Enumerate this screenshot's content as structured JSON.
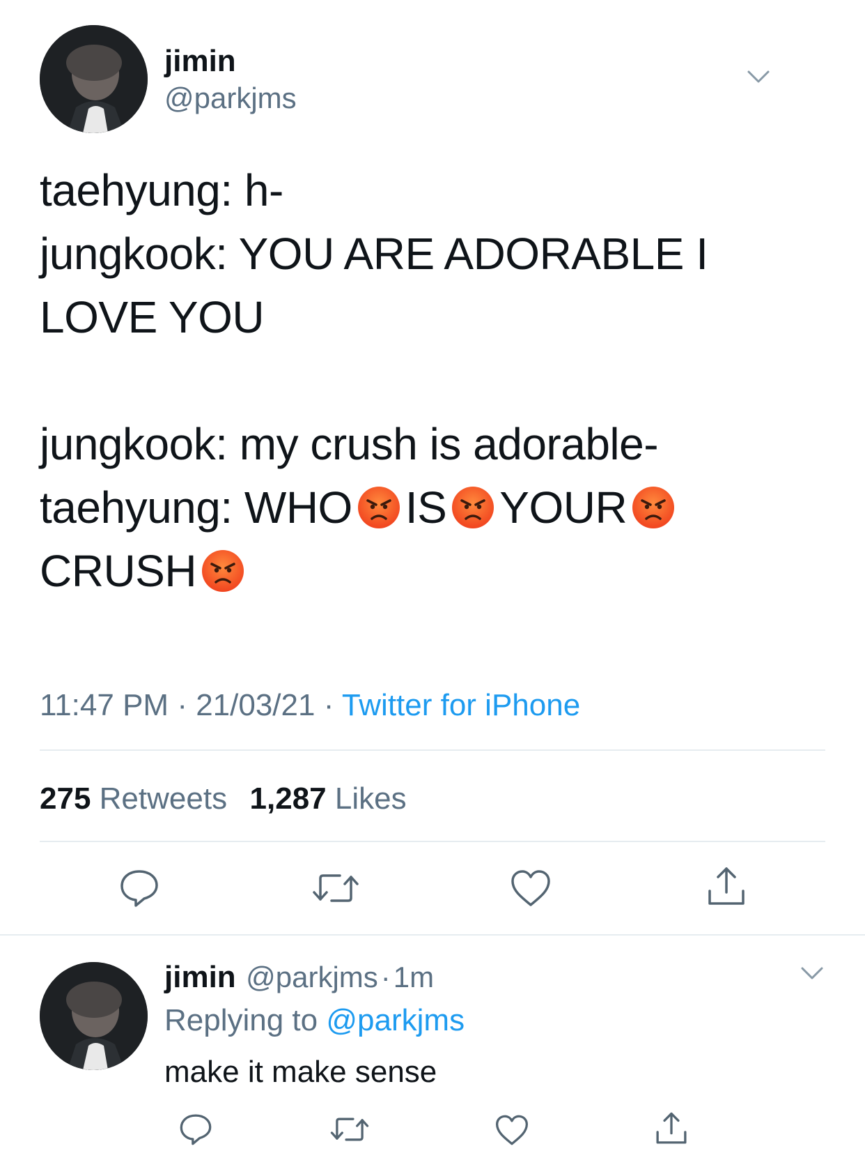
{
  "tweet": {
    "author_name": "jimin",
    "author_handle": "@parkjms",
    "lines": [
      "taehyung: h-",
      "jungkook: YOU ARE ADORABLE I",
      "LOVE YOU",
      "jungkook: my crush is adorable-"
    ],
    "line5_parts": [
      "taehyung: WHO",
      "IS",
      "YOUR"
    ],
    "line6_text": "CRUSH",
    "emoji": "angry-face",
    "time": "11:47 PM",
    "sep": "·",
    "date": "21/03/21",
    "source": "Twitter for iPhone",
    "retweets_count": "275",
    "retweets_label": "Retweets",
    "likes_count": "1,287",
    "likes_label": "Likes"
  },
  "reply": {
    "author_name": "jimin",
    "author_handle": "@parkjms",
    "sep": "·",
    "time_ago": "1m",
    "replying_prefix": "Replying to",
    "replying_handle": "@parkjms",
    "text": "make it make sense"
  },
  "colors": {
    "text": "#0f1419",
    "secondary": "#5b7083",
    "link": "#1d9bf0",
    "divider": "#e6ecf0"
  }
}
